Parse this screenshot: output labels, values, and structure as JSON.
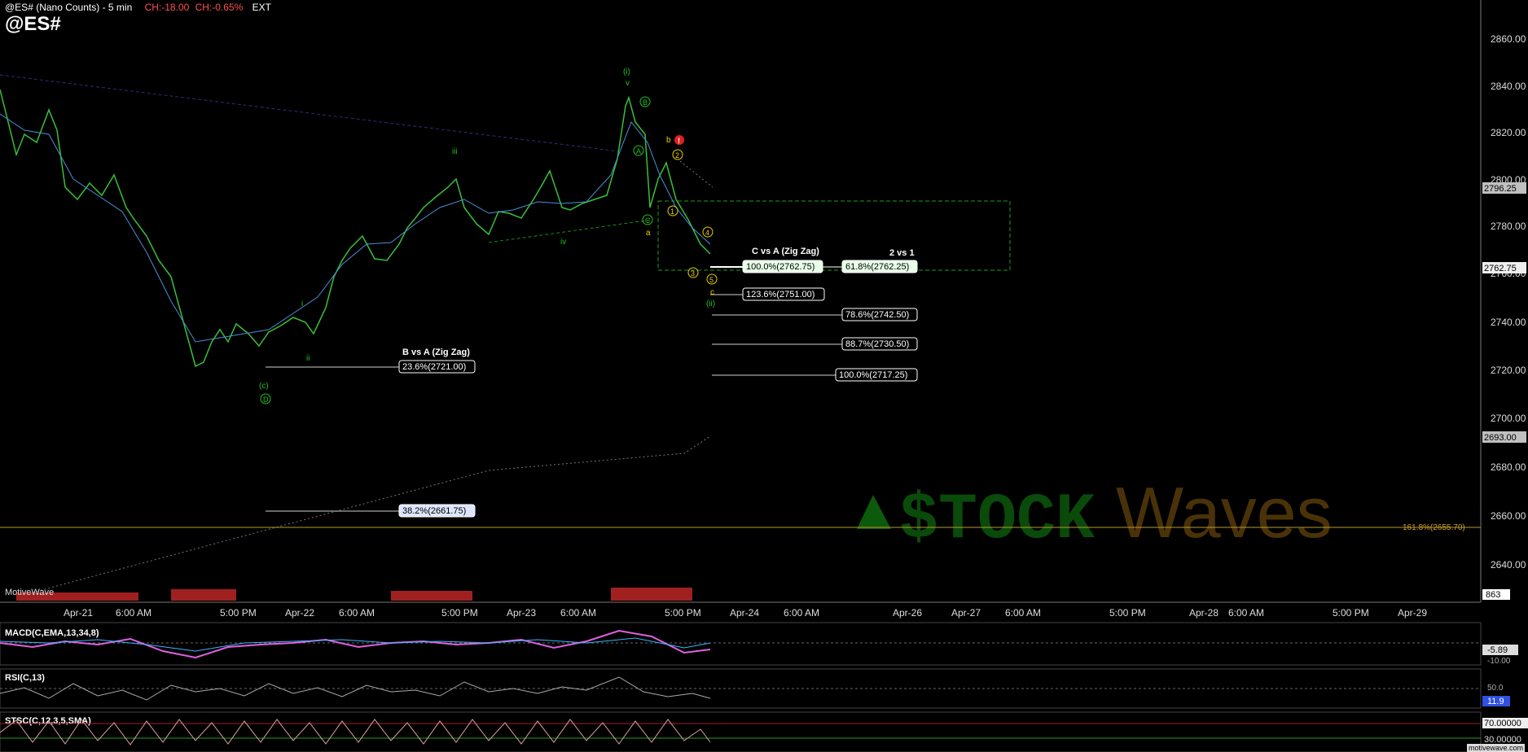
{
  "header": {
    "symbol_line": "@ES# (Nano Counts) - 5 min",
    "change_points": "CH:-18.00",
    "change_pct": "CH:-0.65%",
    "session": "EXT",
    "big_symbol": "@ES#"
  },
  "price_axis": {
    "ticks": [
      "2860.00",
      "2840.00",
      "2820.00",
      "2800.00",
      "2780.00",
      "2760.00",
      "2740.00",
      "2720.00",
      "2700.00",
      "2680.00",
      "2660.00",
      "2640.00"
    ],
    "markers": {
      "upper": "2796.25",
      "last": "2762.75",
      "lower": "2693.00",
      "volume": "863"
    }
  },
  "time_axis": {
    "ticks": [
      "Apr-21",
      "6:00 AM",
      "5:00 PM",
      "Apr-22",
      "6:00 AM",
      "5:00 PM",
      "Apr-23",
      "6:00 AM",
      "5:00 PM",
      "Apr-24",
      "6:00 AM",
      "Apr-26",
      "Apr-27",
      "6:00 AM",
      "5:00 PM",
      "Apr-28",
      "6:00 AM",
      "5:00 PM",
      "Apr-29"
    ]
  },
  "fib_labels": {
    "c_vs_a_title": "C vs A (Zig Zag)",
    "c_vs_a_100": "100.0%(2762.75)",
    "c_vs_a_1236": "123.6%(2751.00)",
    "two_vs_one_title": "2 vs 1",
    "two_vs_one_618": "61.8%(2762.25)",
    "two_vs_one_786": "78.6%(2742.50)",
    "two_vs_one_887": "88.7%(2730.50)",
    "two_vs_one_100": "100.0%(2717.25)",
    "b_vs_a_title": "B vs A (Zig Zag)",
    "b_vs_a_236": "23.6%(2721.00)",
    "b_vs_a_382": "38.2%(2661.75)",
    "ext_1618": "161.8%(2655.70)"
  },
  "wave_labels": {
    "i_top": "(i)",
    "v_top": "v",
    "B_circle": "B",
    "A_circle": "A",
    "C_circle": "C",
    "a_small": "a",
    "b_small": "b",
    "iii": "iii",
    "iv": "iv",
    "i_low": "i",
    "ii_low": "ii",
    "c_paren": "(c)",
    "D_circle": "D",
    "one": "1",
    "two": "2",
    "three": "3",
    "four": "4",
    "five": "5",
    "c_small": "c",
    "ii_paren": "(ii)",
    "alert": "!"
  },
  "indicators": {
    "macd": "MACD(C,EMA,13,34,8)",
    "macd_value": "-5.89",
    "macd_ref": "-10.00",
    "rsi": "RSI(C,13)",
    "rsi_ref": "50.0",
    "rsi_value": "11.9",
    "stoch": "STSC(C,12,3,5,SMA)",
    "stoch_hi": "70.00000",
    "stoch_lo": "30.00000"
  },
  "brand": {
    "watermark_left": "$TOCK",
    "watermark_right": "Waves",
    "platform": "MotiveWave",
    "credit": "motivewave.com"
  },
  "colors": {
    "price_bars": "#38c038",
    "down_bars": "#d03030",
    "ema": "#4a8fd8",
    "fib_line": "#cfcfcf",
    "box": "#1f9a1f",
    "ext_line": "#b89a2a",
    "macd_line": "#e060e0",
    "wave_green": "#22c022",
    "wave_yellow": "#e8d000"
  }
}
